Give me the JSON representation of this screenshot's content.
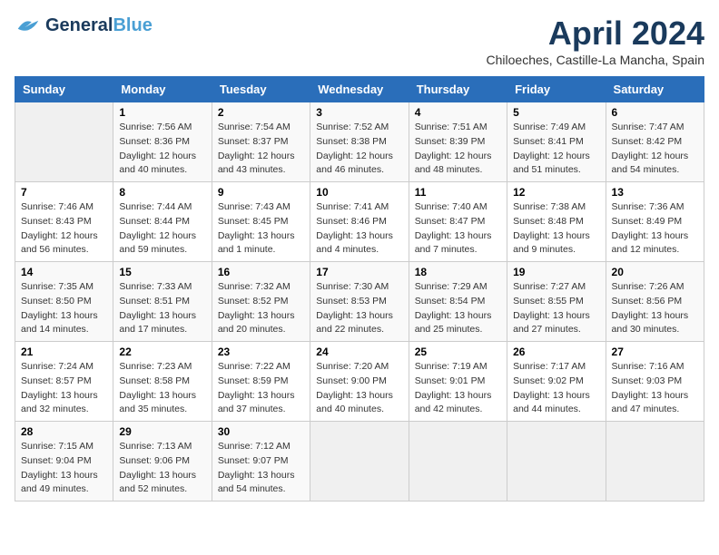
{
  "header": {
    "logo_general": "General",
    "logo_blue": "Blue",
    "month_title": "April 2024",
    "location": "Chiloeches, Castille-La Mancha, Spain"
  },
  "days_of_week": [
    "Sunday",
    "Monday",
    "Tuesday",
    "Wednesday",
    "Thursday",
    "Friday",
    "Saturday"
  ],
  "weeks": [
    [
      {
        "day": "",
        "sunrise": "",
        "sunset": "",
        "daylight": ""
      },
      {
        "day": "1",
        "sunrise": "Sunrise: 7:56 AM",
        "sunset": "Sunset: 8:36 PM",
        "daylight": "Daylight: 12 hours and 40 minutes."
      },
      {
        "day": "2",
        "sunrise": "Sunrise: 7:54 AM",
        "sunset": "Sunset: 8:37 PM",
        "daylight": "Daylight: 12 hours and 43 minutes."
      },
      {
        "day": "3",
        "sunrise": "Sunrise: 7:52 AM",
        "sunset": "Sunset: 8:38 PM",
        "daylight": "Daylight: 12 hours and 46 minutes."
      },
      {
        "day": "4",
        "sunrise": "Sunrise: 7:51 AM",
        "sunset": "Sunset: 8:39 PM",
        "daylight": "Daylight: 12 hours and 48 minutes."
      },
      {
        "day": "5",
        "sunrise": "Sunrise: 7:49 AM",
        "sunset": "Sunset: 8:41 PM",
        "daylight": "Daylight: 12 hours and 51 minutes."
      },
      {
        "day": "6",
        "sunrise": "Sunrise: 7:47 AM",
        "sunset": "Sunset: 8:42 PM",
        "daylight": "Daylight: 12 hours and 54 minutes."
      }
    ],
    [
      {
        "day": "7",
        "sunrise": "Sunrise: 7:46 AM",
        "sunset": "Sunset: 8:43 PM",
        "daylight": "Daylight: 12 hours and 56 minutes."
      },
      {
        "day": "8",
        "sunrise": "Sunrise: 7:44 AM",
        "sunset": "Sunset: 8:44 PM",
        "daylight": "Daylight: 12 hours and 59 minutes."
      },
      {
        "day": "9",
        "sunrise": "Sunrise: 7:43 AM",
        "sunset": "Sunset: 8:45 PM",
        "daylight": "Daylight: 13 hours and 1 minute."
      },
      {
        "day": "10",
        "sunrise": "Sunrise: 7:41 AM",
        "sunset": "Sunset: 8:46 PM",
        "daylight": "Daylight: 13 hours and 4 minutes."
      },
      {
        "day": "11",
        "sunrise": "Sunrise: 7:40 AM",
        "sunset": "Sunset: 8:47 PM",
        "daylight": "Daylight: 13 hours and 7 minutes."
      },
      {
        "day": "12",
        "sunrise": "Sunrise: 7:38 AM",
        "sunset": "Sunset: 8:48 PM",
        "daylight": "Daylight: 13 hours and 9 minutes."
      },
      {
        "day": "13",
        "sunrise": "Sunrise: 7:36 AM",
        "sunset": "Sunset: 8:49 PM",
        "daylight": "Daylight: 13 hours and 12 minutes."
      }
    ],
    [
      {
        "day": "14",
        "sunrise": "Sunrise: 7:35 AM",
        "sunset": "Sunset: 8:50 PM",
        "daylight": "Daylight: 13 hours and 14 minutes."
      },
      {
        "day": "15",
        "sunrise": "Sunrise: 7:33 AM",
        "sunset": "Sunset: 8:51 PM",
        "daylight": "Daylight: 13 hours and 17 minutes."
      },
      {
        "day": "16",
        "sunrise": "Sunrise: 7:32 AM",
        "sunset": "Sunset: 8:52 PM",
        "daylight": "Daylight: 13 hours and 20 minutes."
      },
      {
        "day": "17",
        "sunrise": "Sunrise: 7:30 AM",
        "sunset": "Sunset: 8:53 PM",
        "daylight": "Daylight: 13 hours and 22 minutes."
      },
      {
        "day": "18",
        "sunrise": "Sunrise: 7:29 AM",
        "sunset": "Sunset: 8:54 PM",
        "daylight": "Daylight: 13 hours and 25 minutes."
      },
      {
        "day": "19",
        "sunrise": "Sunrise: 7:27 AM",
        "sunset": "Sunset: 8:55 PM",
        "daylight": "Daylight: 13 hours and 27 minutes."
      },
      {
        "day": "20",
        "sunrise": "Sunrise: 7:26 AM",
        "sunset": "Sunset: 8:56 PM",
        "daylight": "Daylight: 13 hours and 30 minutes."
      }
    ],
    [
      {
        "day": "21",
        "sunrise": "Sunrise: 7:24 AM",
        "sunset": "Sunset: 8:57 PM",
        "daylight": "Daylight: 13 hours and 32 minutes."
      },
      {
        "day": "22",
        "sunrise": "Sunrise: 7:23 AM",
        "sunset": "Sunset: 8:58 PM",
        "daylight": "Daylight: 13 hours and 35 minutes."
      },
      {
        "day": "23",
        "sunrise": "Sunrise: 7:22 AM",
        "sunset": "Sunset: 8:59 PM",
        "daylight": "Daylight: 13 hours and 37 minutes."
      },
      {
        "day": "24",
        "sunrise": "Sunrise: 7:20 AM",
        "sunset": "Sunset: 9:00 PM",
        "daylight": "Daylight: 13 hours and 40 minutes."
      },
      {
        "day": "25",
        "sunrise": "Sunrise: 7:19 AM",
        "sunset": "Sunset: 9:01 PM",
        "daylight": "Daylight: 13 hours and 42 minutes."
      },
      {
        "day": "26",
        "sunrise": "Sunrise: 7:17 AM",
        "sunset": "Sunset: 9:02 PM",
        "daylight": "Daylight: 13 hours and 44 minutes."
      },
      {
        "day": "27",
        "sunrise": "Sunrise: 7:16 AM",
        "sunset": "Sunset: 9:03 PM",
        "daylight": "Daylight: 13 hours and 47 minutes."
      }
    ],
    [
      {
        "day": "28",
        "sunrise": "Sunrise: 7:15 AM",
        "sunset": "Sunset: 9:04 PM",
        "daylight": "Daylight: 13 hours and 49 minutes."
      },
      {
        "day": "29",
        "sunrise": "Sunrise: 7:13 AM",
        "sunset": "Sunset: 9:06 PM",
        "daylight": "Daylight: 13 hours and 52 minutes."
      },
      {
        "day": "30",
        "sunrise": "Sunrise: 7:12 AM",
        "sunset": "Sunset: 9:07 PM",
        "daylight": "Daylight: 13 hours and 54 minutes."
      },
      {
        "day": "",
        "sunrise": "",
        "sunset": "",
        "daylight": ""
      },
      {
        "day": "",
        "sunrise": "",
        "sunset": "",
        "daylight": ""
      },
      {
        "day": "",
        "sunrise": "",
        "sunset": "",
        "daylight": ""
      },
      {
        "day": "",
        "sunrise": "",
        "sunset": "",
        "daylight": ""
      }
    ]
  ]
}
